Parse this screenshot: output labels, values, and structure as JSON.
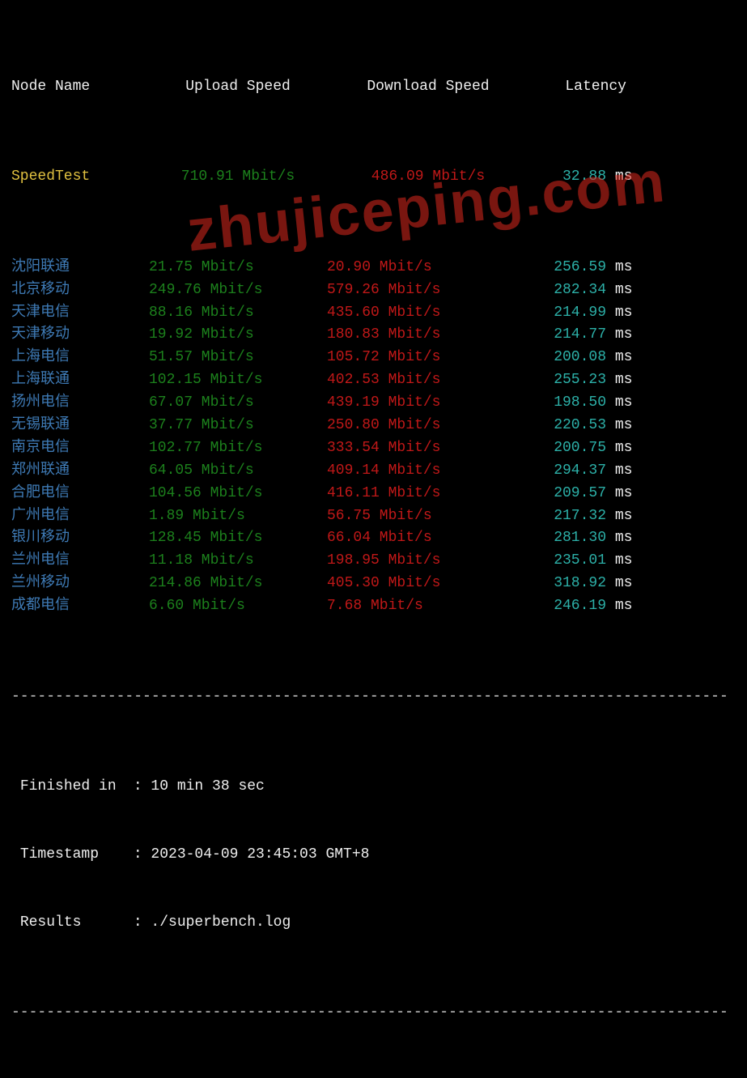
{
  "header": {
    "node": "Node Name",
    "upload": "Upload Speed",
    "download": "Download Speed",
    "latency": "Latency"
  },
  "speedtest": {
    "node": "SpeedTest",
    "upload": "710.91 Mbit/s",
    "download": "486.09 Mbit/s",
    "latency_val": "32.88",
    "latency_unit": "ms"
  },
  "rows": [
    {
      "node": "沈阳联通",
      "upload": "21.75 Mbit/s",
      "download": "20.90 Mbit/s",
      "lat": "256.59",
      "unit": "ms"
    },
    {
      "node": "北京移动",
      "upload": "249.76 Mbit/s",
      "download": "579.26 Mbit/s",
      "lat": "282.34",
      "unit": "ms"
    },
    {
      "node": "天津电信",
      "upload": "88.16 Mbit/s",
      "download": "435.60 Mbit/s",
      "lat": "214.99",
      "unit": "ms"
    },
    {
      "node": "天津移动",
      "upload": "19.92 Mbit/s",
      "download": "180.83 Mbit/s",
      "lat": "214.77",
      "unit": "ms"
    },
    {
      "node": "上海电信",
      "upload": "51.57 Mbit/s",
      "download": "105.72 Mbit/s",
      "lat": "200.08",
      "unit": "ms"
    },
    {
      "node": "上海联通",
      "upload": "102.15 Mbit/s",
      "download": "402.53 Mbit/s",
      "lat": "255.23",
      "unit": "ms"
    },
    {
      "node": "扬州电信",
      "upload": "67.07 Mbit/s",
      "download": "439.19 Mbit/s",
      "lat": "198.50",
      "unit": "ms"
    },
    {
      "node": "无锡联通",
      "upload": "37.77 Mbit/s",
      "download": "250.80 Mbit/s",
      "lat": "220.53",
      "unit": "ms"
    },
    {
      "node": "南京电信",
      "upload": "102.77 Mbit/s",
      "download": "333.54 Mbit/s",
      "lat": "200.75",
      "unit": "ms"
    },
    {
      "node": "郑州联通",
      "upload": "64.05 Mbit/s",
      "download": "409.14 Mbit/s",
      "lat": "294.37",
      "unit": "ms"
    },
    {
      "node": "合肥电信",
      "upload": "104.56 Mbit/s",
      "download": "416.11 Mbit/s",
      "lat": "209.57",
      "unit": "ms"
    },
    {
      "node": "广州电信",
      "upload": "1.89 Mbit/s",
      "download": "56.75 Mbit/s",
      "lat": "217.32",
      "unit": "ms"
    },
    {
      "node": "银川移动",
      "upload": "128.45 Mbit/s",
      "download": "66.04 Mbit/s",
      "lat": "281.30",
      "unit": "ms"
    },
    {
      "node": "兰州电信",
      "upload": "11.18 Mbit/s",
      "download": "198.95 Mbit/s",
      "lat": "235.01",
      "unit": "ms"
    },
    {
      "node": "兰州移动",
      "upload": "214.86 Mbit/s",
      "download": "405.30 Mbit/s",
      "lat": "318.92",
      "unit": "ms"
    },
    {
      "node": "成都电信",
      "upload": "6.60 Mbit/s",
      "download": "7.68 Mbit/s",
      "lat": "246.19",
      "unit": "ms"
    }
  ],
  "divider": "----------------------------------------------------------------------------------",
  "footer": {
    "finished_label": "Finished in",
    "finished_val": "10 min 38 sec",
    "timestamp_label": "Timestamp",
    "timestamp_val": "2023-04-09 23:45:03 GMT+8",
    "results_label": "Results",
    "results_val": "./superbench.log"
  },
  "watermark": "zhujiceping.com"
}
